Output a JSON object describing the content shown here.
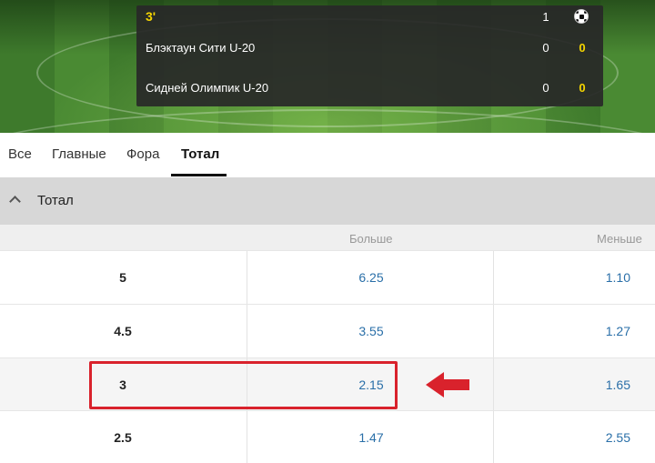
{
  "match": {
    "time": "3'",
    "col1_header": "1",
    "ball_icon": "soccer-ball-icon",
    "teams": [
      {
        "name": "Блэктаун Сити U-20",
        "col1": "0",
        "col2": "0"
      },
      {
        "name": "Сидней Олимпик U-20",
        "col1": "0",
        "col2": "0"
      }
    ]
  },
  "tabs": [
    {
      "label": "Все",
      "active": false
    },
    {
      "label": "Главные",
      "active": false
    },
    {
      "label": "Фора",
      "active": false
    },
    {
      "label": "Тотал",
      "active": true
    }
  ],
  "section": {
    "title": "Тотал",
    "icon": "chevron-up-icon"
  },
  "columns": {
    "over": "Больше",
    "under": "Меньше"
  },
  "rows": [
    {
      "line": "5",
      "over": "6.25",
      "under": "1.10"
    },
    {
      "line": "4.5",
      "over": "3.55",
      "under": "1.27"
    },
    {
      "line": "3",
      "over": "2.15",
      "under": "1.65"
    },
    {
      "line": "2.5",
      "over": "1.47",
      "under": "2.55"
    }
  ],
  "annotation": {
    "highlight_color": "#d9222c",
    "arrow_icon": "left-arrow-icon",
    "highlighted_row": 2
  }
}
